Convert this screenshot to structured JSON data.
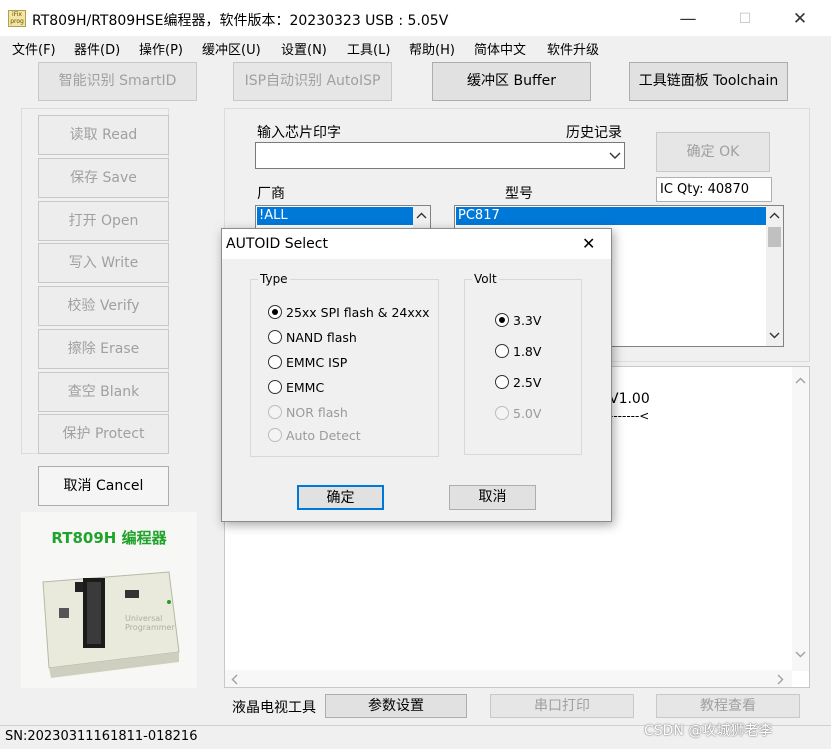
{
  "window": {
    "title": "RT809H/RT809HSE编程器，软件版本：20230323  USB : 5.05V",
    "icon_label": "iFix prog",
    "min_glyph": "—",
    "max_glyph": "☐",
    "close_glyph": "✕"
  },
  "menu": [
    "文件(F)",
    "器件(D)",
    "操作(P)",
    "缓冲区(U)",
    "设置(N)",
    "工具(L)",
    "帮助(H)",
    "简体中文",
    "软件升级"
  ],
  "top_buttons": {
    "smartid": "智能识别 SmartID",
    "autoisp": "ISP自动识别 AutoISP",
    "buffer": "缓冲区 Buffer",
    "toolchain": "工具链面板 Toolchain"
  },
  "side_buttons": [
    "读取 Read",
    "保存 Save",
    "打开 Open",
    "写入 Write",
    "校验 Verify",
    "擦除 Erase",
    "查空 Blank",
    "保护 Protect"
  ],
  "cancel_button": "取消 Cancel",
  "chip": {
    "input_label": "输入芯片印字",
    "history_label": "历史记录",
    "input_value": "",
    "ok_button": "确定 OK",
    "ic_qty": "IC Qty: 40870",
    "vendor_label": "厂商",
    "model_label": "型号",
    "vendor_selected": "!ALL",
    "model_selected": "PC817"
  },
  "log": {
    "version_fragment": "V1.00",
    "dash_fragment": "-------<"
  },
  "product": {
    "title": "RT809H 编程器",
    "device_text": "Universal Programmer"
  },
  "bottom": {
    "lcd_label": "液晶电视工具",
    "params_button": "参数设置",
    "serial_print": "串口打印",
    "tutorial": "教程查看"
  },
  "status": {
    "serial": "SN:20230311161811-018216",
    "watermark": "CSDN @攻城狮老李"
  },
  "dialog": {
    "title": "AUTOID Select",
    "close_glyph": "✕",
    "type_group": "Type",
    "volt_group": "Volt",
    "types": [
      {
        "label": "25xx SPI flash & 24xxx",
        "checked": true,
        "enabled": true
      },
      {
        "label": "NAND flash",
        "checked": false,
        "enabled": true
      },
      {
        "label": "EMMC ISP",
        "checked": false,
        "enabled": true
      },
      {
        "label": "EMMC",
        "checked": false,
        "enabled": true
      },
      {
        "label": "NOR flash",
        "checked": false,
        "enabled": false
      },
      {
        "label": "Auto Detect",
        "checked": false,
        "enabled": false
      }
    ],
    "volts": [
      {
        "label": "3.3V",
        "checked": true,
        "enabled": true
      },
      {
        "label": "1.8V",
        "checked": false,
        "enabled": true
      },
      {
        "label": "2.5V",
        "checked": false,
        "enabled": true
      },
      {
        "label": "5.0V",
        "checked": false,
        "enabled": false
      }
    ],
    "ok_button": "确定",
    "cancel_button": "取消"
  },
  "colors": {
    "selection": "#0078d7",
    "product_title": "#1fa32a"
  }
}
